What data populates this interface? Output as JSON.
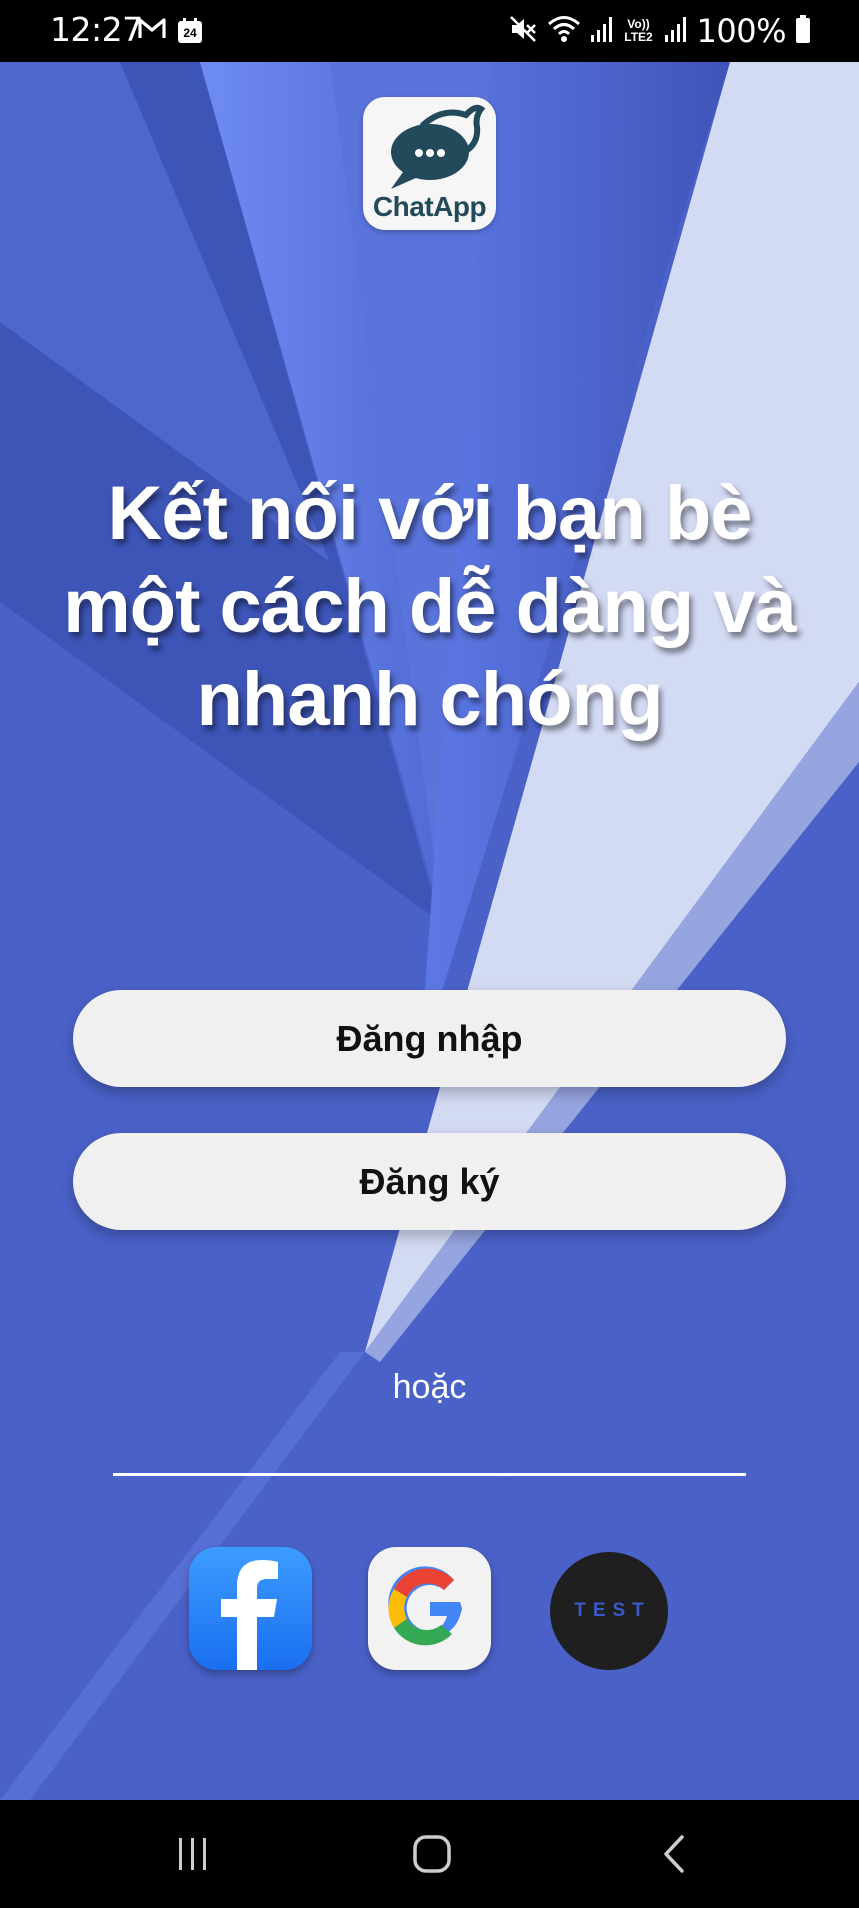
{
  "status_bar": {
    "time": "12:27",
    "calendar_day": "24",
    "battery_text": "100%",
    "left_icons": [
      "gmail-icon",
      "calendar-icon"
    ],
    "right_icons": [
      "mute-icon",
      "wifi-icon",
      "signal-icon",
      "volte-icon",
      "signal-icon",
      "battery-icon"
    ],
    "network_label_top": "Vo))",
    "network_label_bottom": "LTE2"
  },
  "app": {
    "logo_text": "ChatApp",
    "headline_lines": [
      "Kết nối với bạn bè",
      "một cách dễ dàng và",
      "nhanh chóng"
    ],
    "login_button": "Đăng nhập",
    "register_button": "Đăng ký",
    "or_text": "hoặc",
    "social": {
      "facebook_icon": "facebook-icon",
      "google_icon": "google-icon",
      "test_label": "TEST"
    }
  },
  "colors": {
    "background": "#4a61c8",
    "button_bg": "#f0f0f0",
    "test_bg": "#1f1f1f",
    "test_text": "#3b59c8"
  },
  "nav_bar": {
    "icons": [
      "recents-icon",
      "home-icon",
      "back-icon"
    ]
  }
}
